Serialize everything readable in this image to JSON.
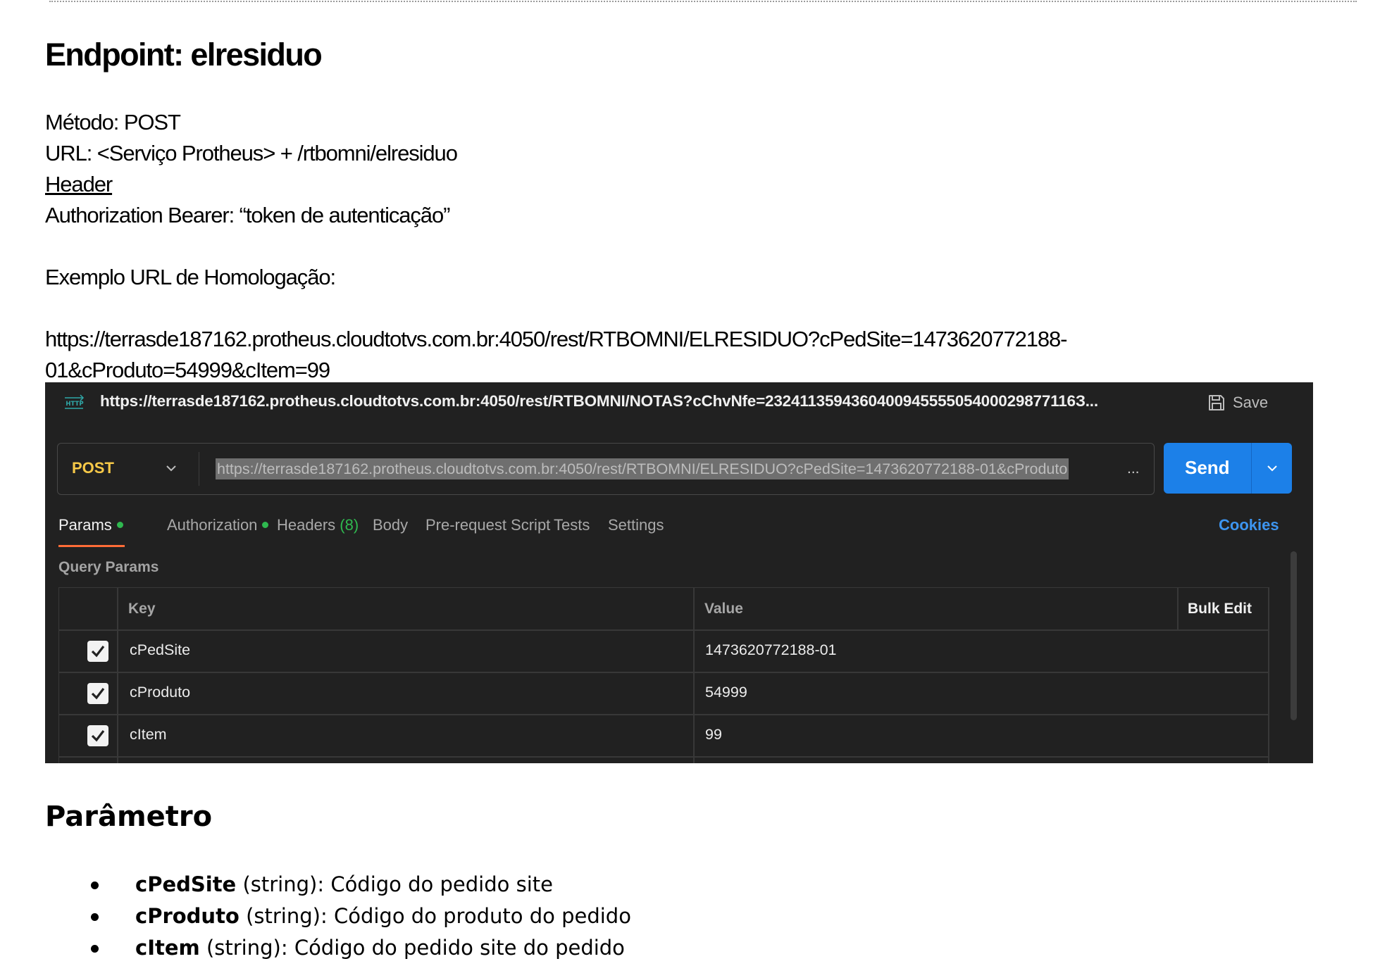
{
  "endpoint_title": "Endpoint: elresiduo",
  "method_line": "Método: POST",
  "url_line": "URL: <Serviço Protheus> + /rtbomni/elresiduo",
  "header_label": "Header",
  "auth_line": "Authorization Bearer: “token de autenticação”",
  "example_label": "Exemplo URL de Homologação:",
  "example_url_line1": "https://terrasde187162.protheus.cloudtotvs.com.br:4050/rest/RTBOMNI/ELRESIDUO?cPedSite=1473620772188-",
  "example_url_line2": "01&cProduto=54999&cItem=99",
  "postman": {
    "http_icon_label": "HTTP",
    "request_title": "https://terrasde187162.protheus.cloudtotvs.com.br:4050/rest/RTBOMNI/NOTAS?cChvNfe=232411359436040094555505400029877116З...",
    "save_label": "Save",
    "method": "POST",
    "url": "https://terrasde187162.protheus.cloudtotvs.com.br:4050/rest/RTBOMNI/ELRESIDUO?cPedSite=1473620772188-01&cProduto",
    "url_ellipsis": "...",
    "send_label": "Send",
    "tabs": {
      "params": "Params",
      "authorization": "Authorization",
      "headers": "Headers",
      "headers_count": "(8)",
      "body": "Body",
      "prerequest": "Pre-request Script",
      "tests": "Tests",
      "settings": "Settings"
    },
    "cookies_label": "Cookies",
    "query_params_label": "Query Params",
    "table": {
      "key_header": "Key",
      "value_header": "Value",
      "bulk_edit": "Bulk Edit",
      "rows": [
        {
          "key": "cPedSite",
          "value": "1473620772188-01"
        },
        {
          "key": "cProduto",
          "value": "54999"
        },
        {
          "key": "cItem",
          "value": "99"
        }
      ]
    },
    "colors": {
      "background": "#212121",
      "send": "#1c80e8",
      "method": "#f7c948",
      "active_tab_underline": "#ff6c37",
      "dot": "#2fb84f",
      "cookies": "#3d95f0"
    }
  },
  "params_title": "Parâmetro",
  "params": [
    {
      "name": "cPedSite",
      "desc": " (string): Código do pedido site"
    },
    {
      "name": "cProduto",
      "desc": " (string): Código do produto do pedido"
    },
    {
      "name": "cItem",
      "desc": " (string): Código do pedido site do pedido"
    }
  ]
}
